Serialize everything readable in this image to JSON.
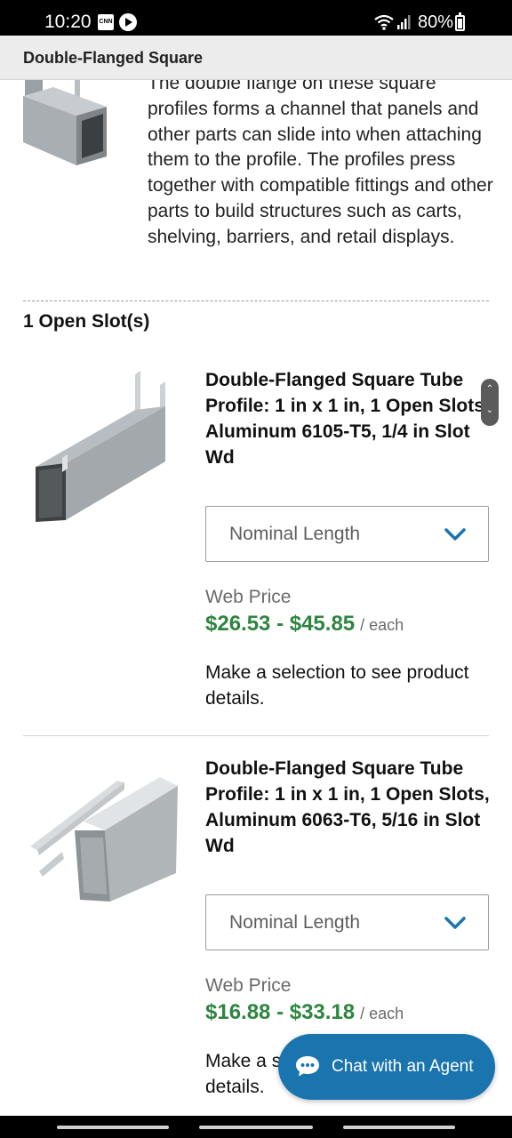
{
  "status_bar": {
    "time": "10:20",
    "battery": "80%",
    "icons": [
      "cnn-icon",
      "play-icon",
      "wifi-icon",
      "signal-icon",
      "battery-icon"
    ]
  },
  "header": {
    "title": "Double-Flanged Square"
  },
  "intro": {
    "text": "The double flange on these square profiles forms a channel that panels and other parts can slide into when attaching them to the profile. The profiles press together with compatible fittings and other parts to build structures such as carts, shelving, barriers, and retail displays."
  },
  "section": {
    "heading": "1 Open Slot(s)"
  },
  "products": [
    {
      "title": "Double-Flanged Square Tube Profile: 1 in x 1 in, 1 Open Slots, Aluminum 6105-T5, 1/4 in Slot Wd",
      "select_label": "Nominal Length",
      "price_label": "Web Price",
      "price": "$26.53 - $45.85",
      "price_unit": "/ each",
      "note": "Make a selection to see product details."
    },
    {
      "title": "Double-Flanged Square Tube Profile: 1 in x 1 in, 1 Open Slots, Aluminum 6063-T6, 5/16 in Slot Wd",
      "select_label": "Nominal Length",
      "price_label": "Web Price",
      "price": "$16.88 - $33.18",
      "price_unit": "/ each",
      "note": "Make a selection to see product details."
    }
  ],
  "chat": {
    "label": "Chat with an Agent"
  },
  "colors": {
    "price": "#2e8540",
    "accent": "#1a74ad",
    "header_bg": "#ececec"
  }
}
